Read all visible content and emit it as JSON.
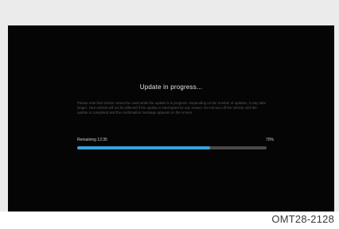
{
  "screen": {
    "title": "Update in progress...",
    "notice": "Please note that vehicle cannot be used while the update is in progress. Depending on the number of updates, it may take longer. Your vehicle will not be affected if the update is interrupted for any reason. Do not turn off the vehicle until the update is completed and the confirmation message appears on the screen.",
    "progress": {
      "time_label": "Remaining 12:35",
      "percent_label": "70%",
      "fraction": 0.7
    }
  },
  "caption": "OMT28-2128",
  "colors": {
    "accent": "#3ba3e0",
    "screen_background": "#050505",
    "frame": "#ebebeb"
  }
}
